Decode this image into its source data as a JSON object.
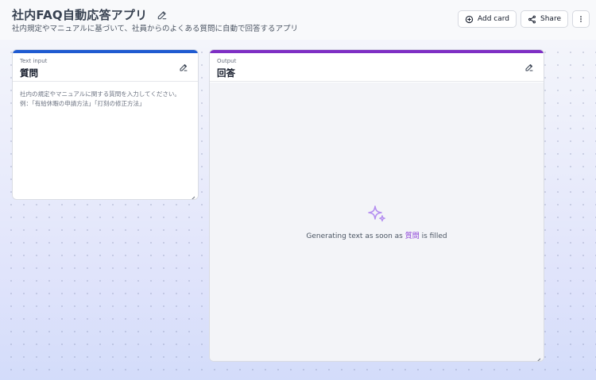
{
  "app": {
    "title": "社内FAQ自動応答アプリ",
    "subtitle": "社内規定やマニュアルに基づいて、社員からのよくある質問に自動で回答するアプリ"
  },
  "toolbar": {
    "add_card_label": "Add card",
    "share_label": "Share"
  },
  "cards": {
    "input": {
      "kind": "Text input",
      "title": "質問",
      "placeholder": "社内の規定やマニュアルに関する質問を入力してください。\n例：「有給休暇の申請方法」「打刻の修正方法」",
      "accent_color": "#1f5bd1"
    },
    "output": {
      "kind": "Output",
      "title": "回答",
      "status_prefix": "Generating text as soon as ",
      "status_ref": "質問",
      "status_suffix": " is filled",
      "accent_color": "#7e2fc4"
    }
  },
  "icons": {
    "title_edit": "pencil-icon",
    "add_card": "plus-circle-icon",
    "share": "share-icon",
    "more": "more-vertical-icon",
    "sparkle": "sparkle-icon",
    "resize": "resize-handle-icon"
  }
}
